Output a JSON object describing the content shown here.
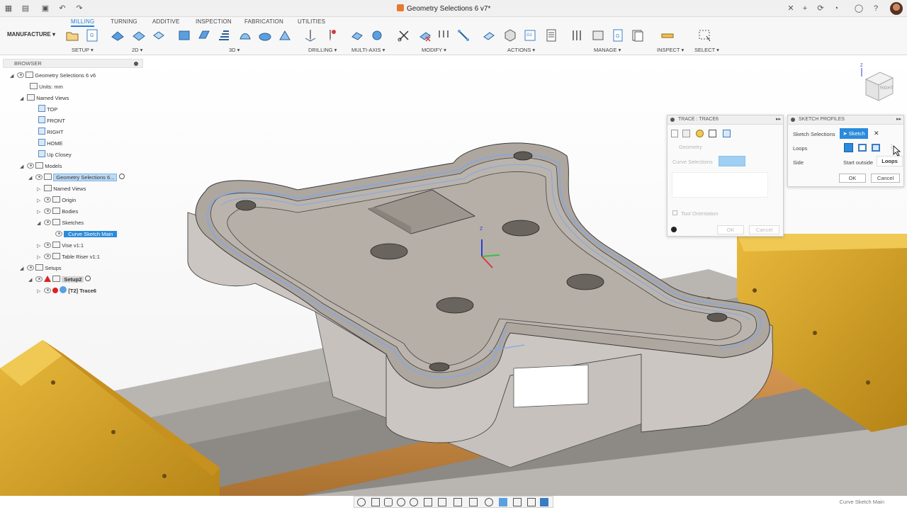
{
  "title_bar": {
    "document_title": "Geometry Selections 6 v7*"
  },
  "ribbon": {
    "workspace": "MANUFACTURE ▾",
    "tabs": [
      "MILLING",
      "TURNING",
      "ADDITIVE",
      "INSPECTION",
      "FABRICATION",
      "UTILITIES"
    ],
    "active_tab": "MILLING",
    "groups": [
      "SETUP ▾",
      "2D ▾",
      "3D ▾",
      "DRILLING ▾",
      "MULTI-AXIS ▾",
      "MODIFY ▾",
      "ACTIONS ▾",
      "MANAGE ▾",
      "INSPECT ▾",
      "SELECT ▾"
    ]
  },
  "browser": {
    "header": "BROWSER",
    "rows": [
      {
        "label": "Geometry Selections 6 v6"
      },
      {
        "label": "Units: mm"
      },
      {
        "label": "Named Views"
      },
      {
        "label": "TOP"
      },
      {
        "label": "FRONT"
      },
      {
        "label": "RIGHT"
      },
      {
        "label": "HOME"
      },
      {
        "label": "Up Closey"
      },
      {
        "label": "Models"
      },
      {
        "label": "Geometry Selections 6..."
      },
      {
        "label": "Named Views"
      },
      {
        "label": "Origin"
      },
      {
        "label": "Bodies"
      },
      {
        "label": "Sketches"
      },
      {
        "label": "Curve Sketch Main"
      },
      {
        "label": "Vise v1:1"
      },
      {
        "label": "Table Riser v1:1"
      },
      {
        "label": "Setups"
      },
      {
        "label": "Setup2"
      },
      {
        "label": "[T2] Trace6"
      }
    ]
  },
  "trace_dialog": {
    "title": "TRACE : TRACE6",
    "section": "Geometry",
    "curve_selections_label": "Curve Selections",
    "tool_orientation_label": "Tool Orientation",
    "ok": "OK",
    "cancel": "Cancel"
  },
  "sketch_profiles_dialog": {
    "title": "SKETCH PROFILES",
    "sketch_selections_label": "Sketch Selections",
    "sketch_chip": "Sketch",
    "loops_label": "Loops",
    "side_label": "Side",
    "side_value": "Start outside",
    "loops_tooltip": "Loops",
    "ok": "OK",
    "cancel": "Cancel"
  },
  "viewcube": {
    "face": "RIGHT",
    "axis": "Z"
  },
  "status_bar": {
    "text": "Curve Sketch Main"
  },
  "colors": {
    "accent": "#2a8bdc",
    "part": "#b3aca6",
    "vise": "#d7a325",
    "toolpath": "#7fa8e8"
  }
}
